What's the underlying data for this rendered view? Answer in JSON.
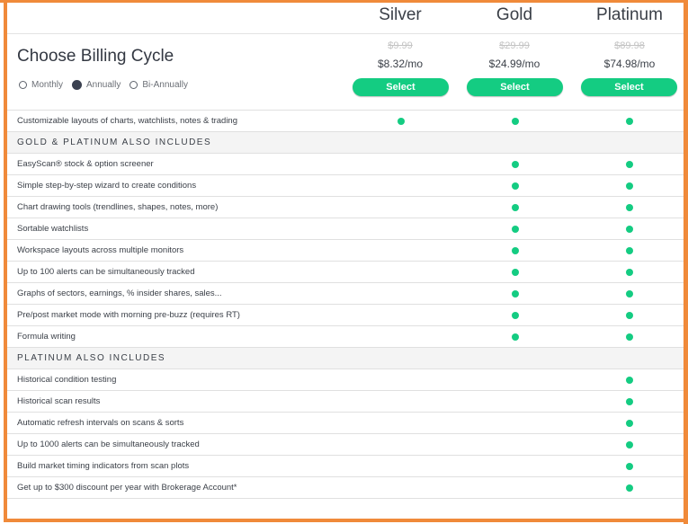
{
  "plans": [
    {
      "name": "Silver",
      "old_price": "$9.99",
      "price": "$8.32/mo",
      "select_label": "Select"
    },
    {
      "name": "Gold",
      "old_price": "$29.99",
      "price": "$24.99/mo",
      "select_label": "Select"
    },
    {
      "name": "Platinum",
      "old_price": "$89.98",
      "price": "$74.98/mo",
      "select_label": "Select"
    }
  ],
  "billing": {
    "title": "Choose Billing Cycle",
    "options": [
      {
        "label": "Monthly",
        "checked": false
      },
      {
        "label": "Annually",
        "checked": true
      },
      {
        "label": "Bi-Annually",
        "checked": false
      }
    ]
  },
  "accent_color": "#14cc82",
  "frame_color": "#f08a3a",
  "rows": [
    {
      "type": "feature",
      "label": "Customizable layouts of charts, watchlists, notes & trading",
      "silver": true,
      "gold": true,
      "platinum": true
    },
    {
      "type": "section",
      "label": "GOLD & PLATINUM ALSO INCLUDES"
    },
    {
      "type": "feature",
      "label": "EasyScan® stock & option screener",
      "silver": false,
      "gold": true,
      "platinum": true
    },
    {
      "type": "feature",
      "label": "Simple step-by-step wizard to create conditions",
      "silver": false,
      "gold": true,
      "platinum": true
    },
    {
      "type": "feature",
      "label": "Chart drawing tools (trendlines, shapes, notes, more)",
      "silver": false,
      "gold": true,
      "platinum": true
    },
    {
      "type": "feature",
      "label": "Sortable watchlists",
      "silver": false,
      "gold": true,
      "platinum": true
    },
    {
      "type": "feature",
      "label": "Workspace layouts across multiple monitors",
      "silver": false,
      "gold": true,
      "platinum": true
    },
    {
      "type": "feature",
      "label": "Up to 100 alerts can be simultaneously tracked",
      "silver": false,
      "gold": true,
      "platinum": true
    },
    {
      "type": "feature",
      "label": "Graphs of sectors, earnings, % insider shares, sales...",
      "silver": false,
      "gold": true,
      "platinum": true
    },
    {
      "type": "feature",
      "label": "Pre/post market mode with morning pre-buzz (requires RT)",
      "silver": false,
      "gold": true,
      "platinum": true
    },
    {
      "type": "feature",
      "label": "Formula writing",
      "silver": false,
      "gold": true,
      "platinum": true
    },
    {
      "type": "section",
      "label": "PLATINUM ALSO INCLUDES"
    },
    {
      "type": "feature",
      "label": "Historical condition testing",
      "silver": false,
      "gold": false,
      "platinum": true
    },
    {
      "type": "feature",
      "label": "Historical scan results",
      "silver": false,
      "gold": false,
      "platinum": true
    },
    {
      "type": "feature",
      "label": "Automatic refresh intervals on scans & sorts",
      "silver": false,
      "gold": false,
      "platinum": true
    },
    {
      "type": "feature",
      "label": "Up to 1000 alerts can be simultaneously tracked",
      "silver": false,
      "gold": false,
      "platinum": true
    },
    {
      "type": "feature",
      "label": "Build market timing indicators from scan plots",
      "silver": false,
      "gold": false,
      "platinum": true
    },
    {
      "type": "feature",
      "label": "Get up to $300 discount per year with Brokerage Account*",
      "silver": false,
      "gold": false,
      "platinum": true
    }
  ]
}
